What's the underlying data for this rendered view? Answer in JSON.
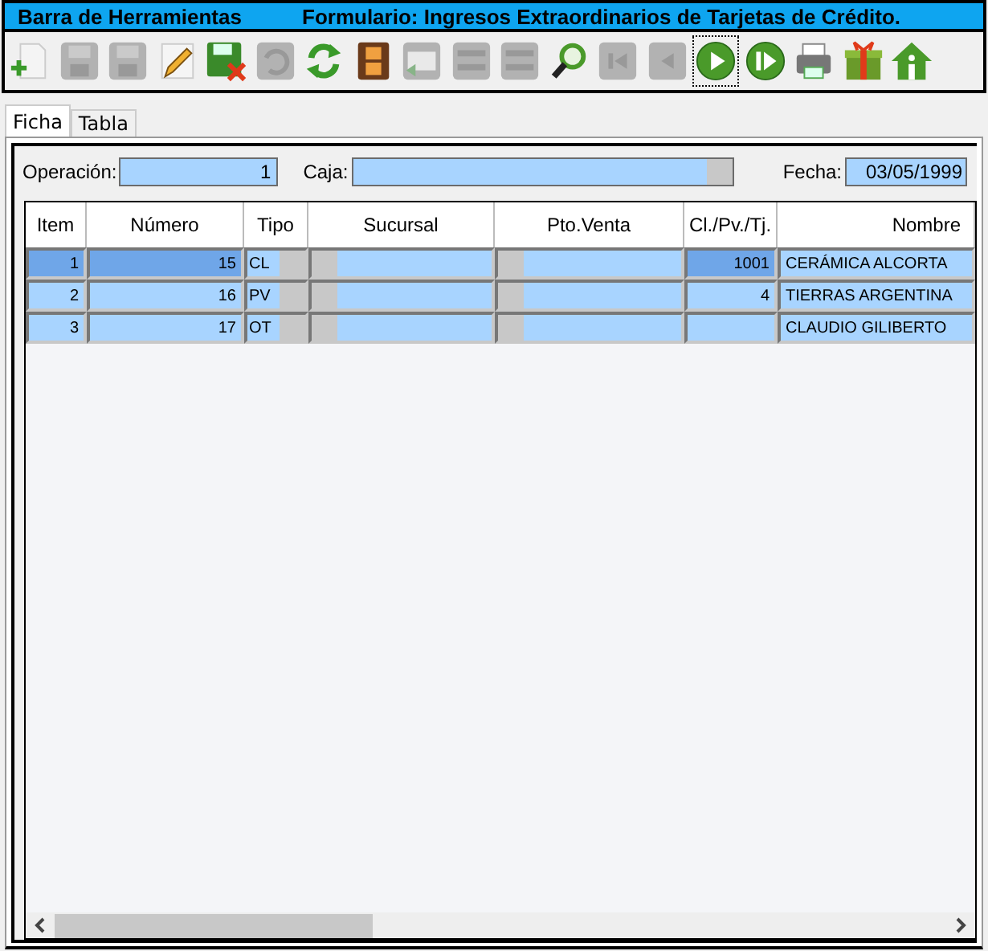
{
  "title_bar": {
    "left": "Barra de Herramientas",
    "right": "Formulario: Ingresos Extraordinarios de Tarjetas de Crédito."
  },
  "toolbar": [
    {
      "kind": "new",
      "disabled": false,
      "focused": false
    },
    {
      "kind": "save",
      "disabled": true,
      "focused": false
    },
    {
      "kind": "save-plus",
      "disabled": true,
      "focused": false
    },
    {
      "kind": "pencil",
      "disabled": false,
      "focused": false
    },
    {
      "kind": "save-delete",
      "disabled": false,
      "focused": false
    },
    {
      "kind": "undo",
      "disabled": true,
      "focused": false
    },
    {
      "kind": "refresh",
      "disabled": false,
      "focused": false
    },
    {
      "kind": "film",
      "disabled": false,
      "focused": false
    },
    {
      "kind": "mail",
      "disabled": true,
      "focused": false
    },
    {
      "kind": "list",
      "disabled": true,
      "focused": false
    },
    {
      "kind": "list",
      "disabled": true,
      "focused": false
    },
    {
      "kind": "search",
      "disabled": false,
      "focused": false
    },
    {
      "kind": "first",
      "disabled": true,
      "focused": false
    },
    {
      "kind": "prev",
      "disabled": true,
      "focused": false
    },
    {
      "kind": "next",
      "disabled": false,
      "focused": true
    },
    {
      "kind": "last",
      "disabled": false,
      "focused": false
    },
    {
      "kind": "printer",
      "disabled": false,
      "focused": false
    },
    {
      "kind": "gift",
      "disabled": false,
      "focused": false
    },
    {
      "kind": "home",
      "disabled": false,
      "focused": false
    }
  ],
  "tabs": [
    {
      "label": "Ficha",
      "selected": true
    },
    {
      "label": "Tabla",
      "selected": false
    }
  ],
  "form": {
    "operacion_label": "Operación:",
    "operacion": "1",
    "caja_label": "Caja:",
    "fecha_label": "Fecha:",
    "fecha": "03/05/1999"
  },
  "table": {
    "columns": [
      "Item",
      "Número",
      "Tipo",
      "Sucursal",
      "Pto.Venta",
      "Cl./Pv./Tj.",
      "Nombre"
    ],
    "rows": [
      {
        "item": "1",
        "numero": "15",
        "tipo": "CL",
        "cl": "1001",
        "nombre": "CERÁMICA ALCORTA",
        "selected": true
      },
      {
        "item": "2",
        "numero": "16",
        "tipo": "PV",
        "cl": "4",
        "nombre": "TIERRAS ARGENTINA",
        "selected": false
      },
      {
        "item": "3",
        "numero": "17",
        "tipo": "OT",
        "cl": "",
        "nombre": "CLAUDIO GILIBERTO",
        "selected": false
      }
    ]
  }
}
